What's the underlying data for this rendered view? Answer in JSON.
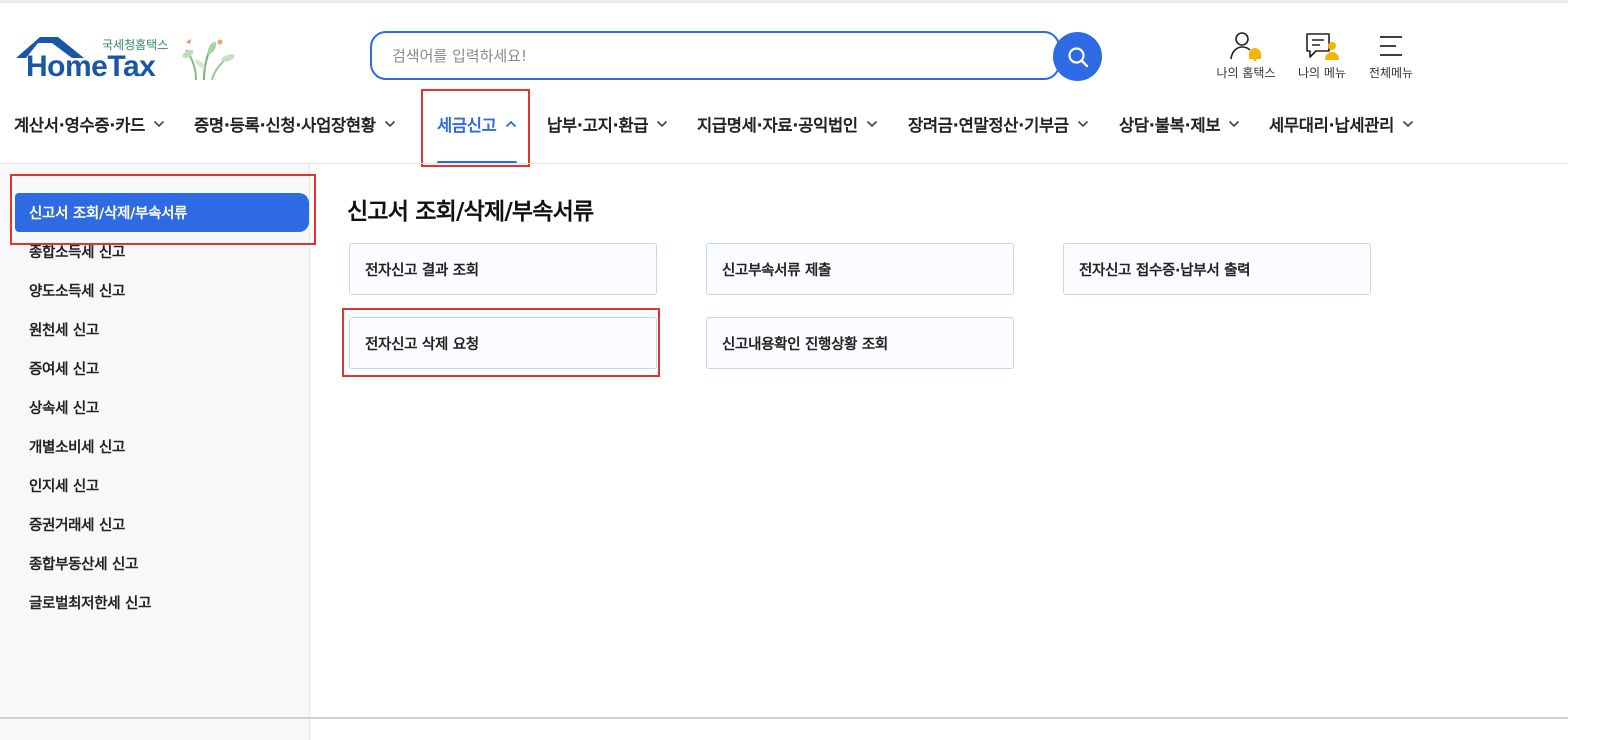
{
  "brand": {
    "small_text": "국세청홈택스",
    "logo_text": "HomeTax",
    "colors": {
      "primary": "#2d6ae3",
      "logo_blue": "#1a56a8",
      "highlight": "#e3342b"
    }
  },
  "search": {
    "placeholder": "검색어를 입력하세요!",
    "value": "",
    "button_icon": "search-icon"
  },
  "utility": [
    {
      "label": "나의 홈택스",
      "icon": "user-bell-icon"
    },
    {
      "label": "나의 메뉴",
      "icon": "my-menu-icon"
    },
    {
      "label": "전체메뉴",
      "icon": "hamburger-icon"
    }
  ],
  "gnb": {
    "items": [
      {
        "label": "계산서·영수증·카드",
        "expanded": false
      },
      {
        "label": "증명·등록·신청·사업장현황",
        "expanded": false
      },
      {
        "label": "세금신고",
        "expanded": true,
        "active": true
      },
      {
        "label": "납부·고지·환급",
        "expanded": false
      },
      {
        "label": "지급명세·자료·공익법인",
        "expanded": false
      },
      {
        "label": "장려금·연말정산·기부금",
        "expanded": false
      },
      {
        "label": "상담·불복·제보",
        "expanded": false
      },
      {
        "label": "세무대리·납세관리",
        "expanded": false
      }
    ]
  },
  "sidebar": {
    "active": "신고서 조회/삭제/부속서류",
    "items": [
      "종합소득세 신고",
      "양도소득세 신고",
      "원천세 신고",
      "증여세 신고",
      "상속세 신고",
      "개별소비세 신고",
      "인지세 신고",
      "증권거래세 신고",
      "종합부동산세 신고",
      "글로벌최저한세 신고"
    ]
  },
  "main": {
    "title": "신고서 조회/삭제/부속서류",
    "cards": [
      "전자신고 결과 조회",
      "신고부속서류 제출",
      "전자신고 접수증·납부서 출력",
      "전자신고 삭제 요청",
      "신고내용확인 진행상황 조회"
    ]
  }
}
